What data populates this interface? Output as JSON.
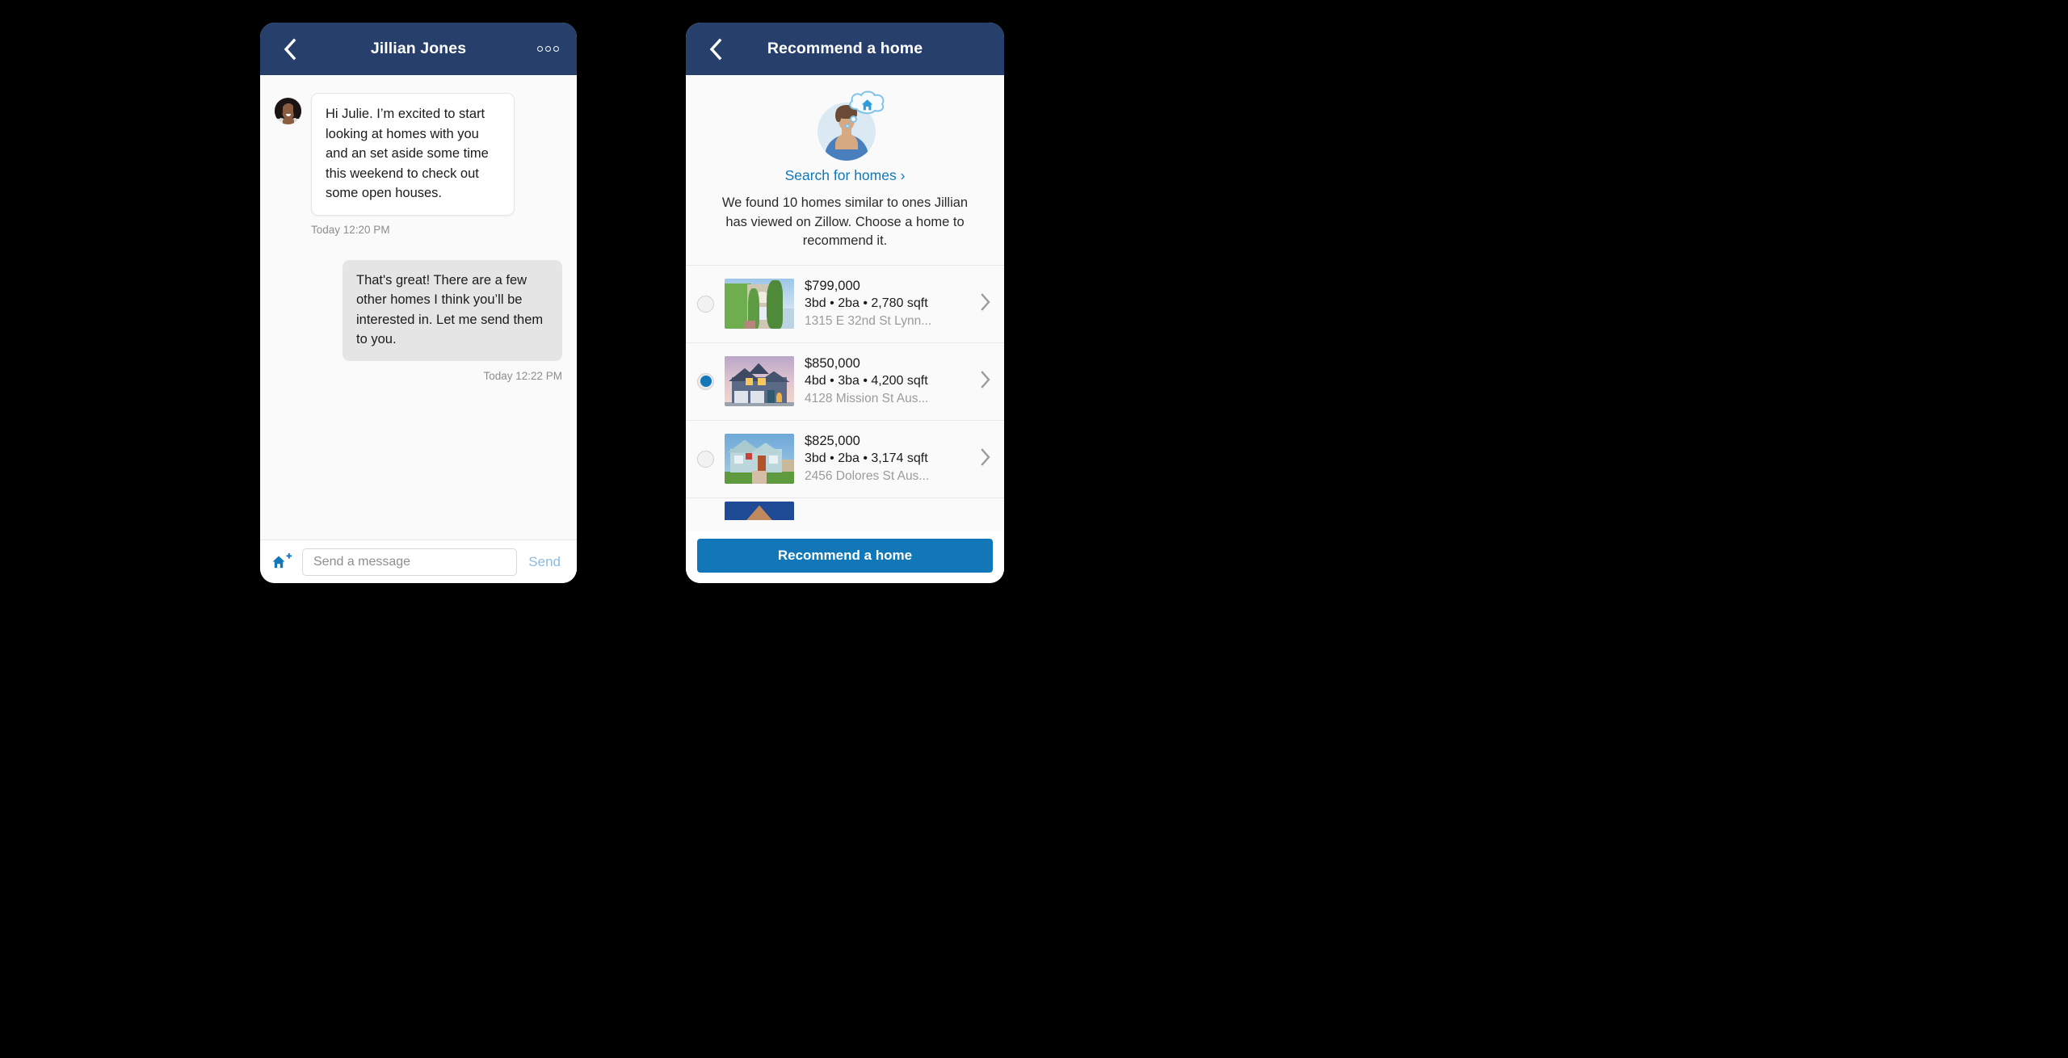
{
  "theme": {
    "navy": "#27406b",
    "accent_blue": "#1277b8",
    "link_blue": "#1277b8",
    "send_disabled": "#8ebbdd",
    "page_bg": "#000000"
  },
  "chat_screen": {
    "nav": {
      "back_icon": "chevron-left-icon",
      "title": "Jillian Jones",
      "more_icon": "overflow-dots-icon"
    },
    "messages": [
      {
        "direction": "in",
        "avatar": "contact-avatar",
        "text": "Hi Julie. I’m excited to start looking at homes with you and an set aside some time this weekend to check out some open houses.",
        "timestamp": "Today 12:20 PM"
      },
      {
        "direction": "out",
        "text": "That's great! There are a few other homes I think you’ll be interested in. Let me send them to you.",
        "timestamp": "Today  12:22 PM"
      }
    ],
    "composer": {
      "attach_icon": "home-plus-icon",
      "input_value": "",
      "input_placeholder": "Send a message",
      "send_label": "Send"
    }
  },
  "recommend_screen": {
    "nav": {
      "back_icon": "chevron-left-icon",
      "title": "Recommend a home"
    },
    "hero": {
      "illustration": "person-thinking-about-home-icon",
      "link_label": "Search for homes ›",
      "description": "We found 10 homes similar to ones Jillian has viewed on Zillow. Choose a home to recommend it."
    },
    "listings": [
      {
        "selected": false,
        "price": "$799,000",
        "specs": "3bd • 2ba • 2,780 sqft",
        "address": "1315 E 32nd St Lynn...",
        "thumb": "home-photo-stucco",
        "chevron_icon": "chevron-right-icon"
      },
      {
        "selected": true,
        "price": "$850,000",
        "specs": "4bd • 3ba • 4,200 sqft",
        "address": "4128 Mission St Aus...",
        "thumb": "home-photo-twilight",
        "chevron_icon": "chevron-right-icon"
      },
      {
        "selected": false,
        "price": "$825,000",
        "specs": "3bd • 2ba • 3,174 sqft",
        "address": "2456 Dolores St Aus...",
        "thumb": "home-photo-bungalow",
        "chevron_icon": "chevron-right-icon"
      },
      {
        "selected": false,
        "price": "",
        "specs": "",
        "address": "",
        "thumb": "home-photo-partial",
        "chevron_icon": "chevron-right-icon"
      }
    ],
    "cta_label": "Recommend a home"
  }
}
